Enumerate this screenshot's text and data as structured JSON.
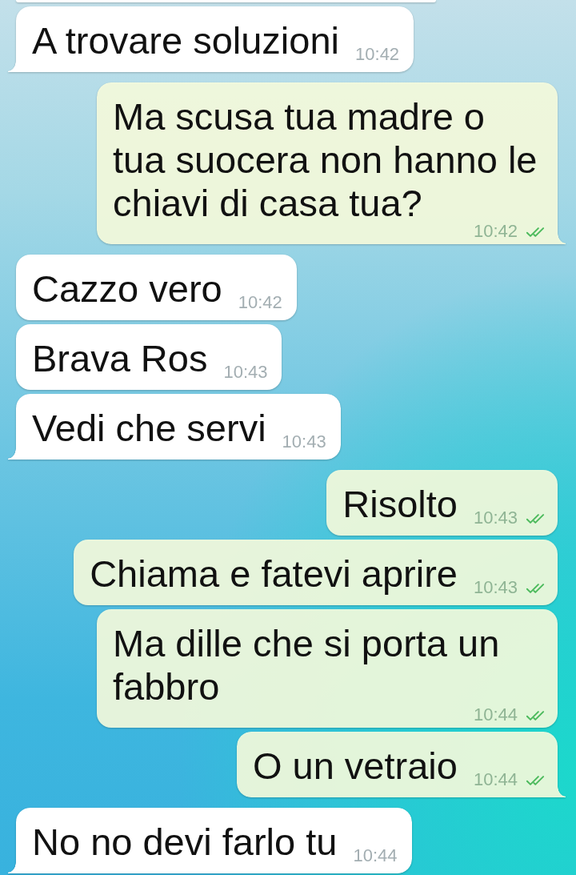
{
  "messages": [
    {
      "kind": "clipped",
      "outgoing": false
    },
    {
      "kind": "text",
      "outgoing": false,
      "text": "A trovare soluzioni",
      "time": "10:42",
      "tail": true
    },
    {
      "kind": "text",
      "outgoing": true,
      "text": "Ma scusa tua madre o tua suocera non hanno le chiavi di casa tua?",
      "time": "10:42",
      "read": true,
      "tail": true
    },
    {
      "kind": "text",
      "outgoing": false,
      "text": "Cazzo vero",
      "time": "10:42",
      "tail": false
    },
    {
      "kind": "text",
      "outgoing": false,
      "text": "Brava Ros",
      "time": "10:43",
      "tail": false
    },
    {
      "kind": "text",
      "outgoing": false,
      "text": "Vedi che servi",
      "time": "10:43",
      "tail": true
    },
    {
      "kind": "text",
      "outgoing": true,
      "text": "Risolto",
      "time": "10:43",
      "read": true,
      "tail": false
    },
    {
      "kind": "text",
      "outgoing": true,
      "text": "Chiama e fatevi aprire",
      "time": "10:43",
      "read": true,
      "tail": false
    },
    {
      "kind": "text",
      "outgoing": true,
      "text": "Ma dille che si porta un fabbro",
      "time": "10:44",
      "read": true,
      "tail": false
    },
    {
      "kind": "text",
      "outgoing": true,
      "text": "O un vetraio",
      "time": "10:44",
      "read": true,
      "tail": true
    },
    {
      "kind": "text",
      "outgoing": false,
      "text": "No no devi farlo tu",
      "time": "10:44",
      "tail": true
    }
  ]
}
